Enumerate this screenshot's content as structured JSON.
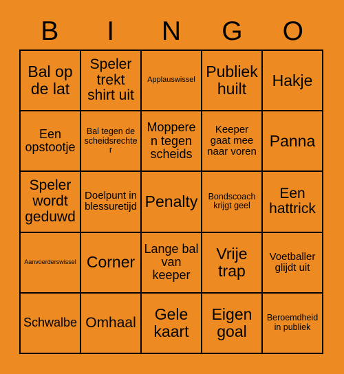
{
  "card": {
    "background_color": "#ED8B22",
    "text_color": "#000000",
    "border_color": "#000000",
    "header": {
      "letters": [
        "B",
        "I",
        "N",
        "G",
        "O"
      ]
    },
    "grid": {
      "columns": 5,
      "rows": 5,
      "cells": [
        {
          "text": "Bal op de lat",
          "size": "fs-xl"
        },
        {
          "text": "Speler trekt shirt uit",
          "size": "fs-lg"
        },
        {
          "text": "Applauswissel",
          "size": "fs-xxs"
        },
        {
          "text": "Publiek huilt",
          "size": "fs-xl"
        },
        {
          "text": "Hakje",
          "size": "fs-xl"
        },
        {
          "text": "Een opstootje",
          "size": "fs-md"
        },
        {
          "text": "Bal tegen de scheidsrechter",
          "size": "fs-xs"
        },
        {
          "text": "Mopperen tegen scheids",
          "size": "fs-md"
        },
        {
          "text": "Keeper gaat mee naar voren",
          "size": "fs-sm"
        },
        {
          "text": "Panna",
          "size": "fs-xl"
        },
        {
          "text": "Speler wordt geduwd",
          "size": "fs-lg"
        },
        {
          "text": "Doelpunt in blessuretijd",
          "size": "fs-sm"
        },
        {
          "text": "Penalty",
          "size": "fs-xl"
        },
        {
          "text": "Bondscoach krijgt geel",
          "size": "fs-xs"
        },
        {
          "text": "Een hattrick",
          "size": "fs-lg"
        },
        {
          "text": "Aanvoerderswissel",
          "size": "fs-tiny"
        },
        {
          "text": "Corner",
          "size": "fs-xl"
        },
        {
          "text": "Lange bal van keeper",
          "size": "fs-md"
        },
        {
          "text": "Vrije trap",
          "size": "fs-xl"
        },
        {
          "text": "Voetballer glijdt uit",
          "size": "fs-sm"
        },
        {
          "text": "Schwalbe",
          "size": "fs-md"
        },
        {
          "text": "Omhaal",
          "size": "fs-lg"
        },
        {
          "text": "Gele kaart",
          "size": "fs-xl"
        },
        {
          "text": "Eigen goal",
          "size": "fs-xl"
        },
        {
          "text": "Beroemdheid in publiek",
          "size": "fs-xs"
        }
      ]
    }
  }
}
